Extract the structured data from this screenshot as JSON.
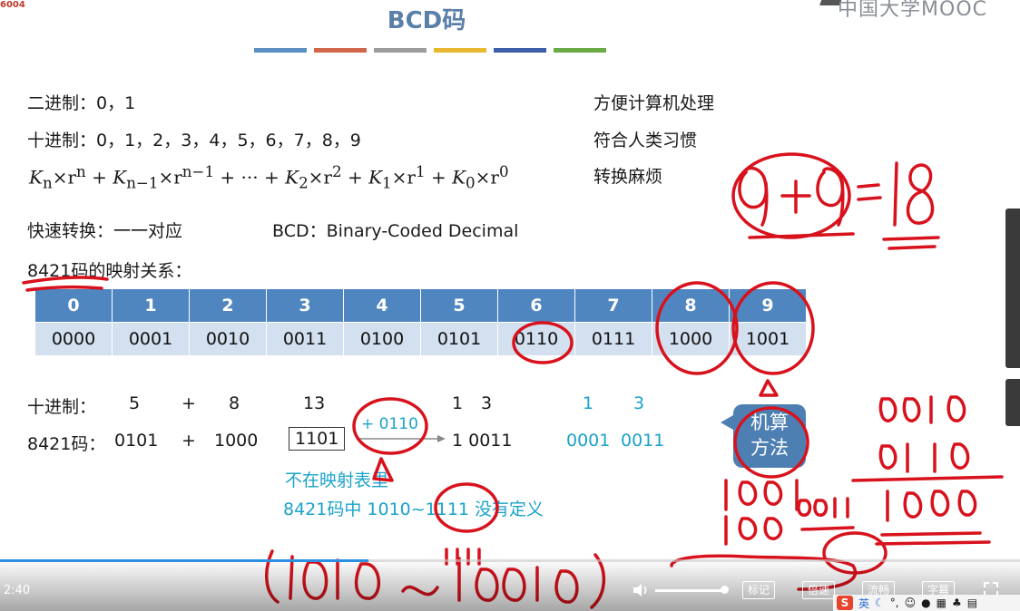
{
  "slide": {
    "title": "BCD码",
    "logo": "中国大学MOOC",
    "corner_mark": "6004",
    "title_bar_colors": [
      "#5b8fc4",
      "#d0664a",
      "#9c9c9c",
      "#e8b830",
      "#3d5fa8",
      "#6aab48"
    ],
    "binary_line": "二进制：0，1",
    "decimal_line": "十进制：0，1，2，3，4，5，6，7，8，9",
    "formula": {
      "k_n": "K",
      "sub_n": "n",
      "r_n": "×r",
      "sup_n": "n",
      "plus1": " + ",
      "k_n1": "K",
      "sub_n1": "n−1",
      "r_n1": "×r",
      "sup_n1": "n−1",
      "mid": " + ··· + ",
      "k_2": "K",
      "sub_2": "2",
      "r_2": "×r",
      "sup_2": "2",
      "plus2": " + ",
      "k_1": "K",
      "sub_1": "1",
      "r_1": "×r",
      "sup_1": "1",
      "plus3": " + ",
      "k_0": "K",
      "sub_0": "0",
      "r_0": "×r",
      "sup_0": "0"
    },
    "side_notes": [
      "方便计算机处理",
      "符合人类习惯",
      "转换麻烦"
    ],
    "quick_convert": "快速转换：一一对应",
    "bcd_definition": "BCD：Binary-Coded Decimal",
    "mapping_title": "8421码的映射关系：",
    "mapping_header": [
      "0",
      "1",
      "2",
      "3",
      "4",
      "5",
      "6",
      "7",
      "8",
      "9"
    ],
    "mapping_codes": [
      "0000",
      "0001",
      "0010",
      "0011",
      "0100",
      "0101",
      "0110",
      "0111",
      "1000",
      "1001"
    ],
    "example": {
      "dec_label": "十进制：",
      "dec_a": "5",
      "dec_plus": "+",
      "dec_b": "8",
      "dec_sum": "13",
      "dec_result_1": "1",
      "dec_result_3": "3",
      "dec_cyan_1": "1",
      "dec_cyan_3": "3",
      "code_label": "8421码：",
      "code_a": "0101",
      "code_plus": "+",
      "code_b": "1000",
      "code_sum": "1101",
      "correction": "+ 0110",
      "code_result": "1 0011",
      "code_cyan_1": "0001",
      "code_cyan_2": "0011"
    },
    "note_line1": "不在映射表里",
    "note_line2": "8421码中 1010~1111 没有定义",
    "bubble_text": [
      "机算",
      "方法"
    ]
  },
  "player": {
    "time": "2:40",
    "progress_fraction": 0.6,
    "volume_fraction": 0.95,
    "buttons": [
      "标记",
      "倍速",
      "流畅",
      "字幕"
    ]
  },
  "tray": {
    "logo": "S",
    "lang": "英"
  }
}
